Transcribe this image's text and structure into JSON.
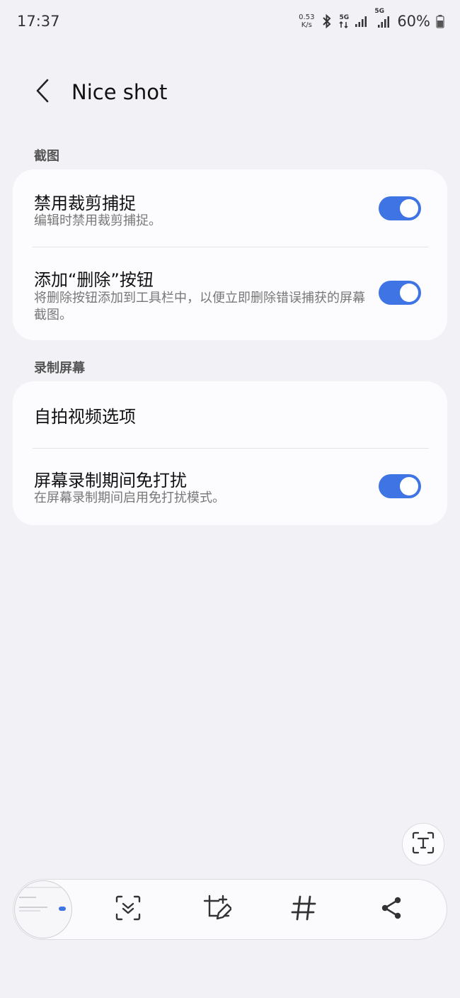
{
  "status_bar": {
    "time": "17:37",
    "net_speed_value": "0.53",
    "net_speed_unit": "K/s",
    "sig1_label": "5G",
    "sig2_label": "5G",
    "battery": "60%"
  },
  "header": {
    "title": "Nice shot"
  },
  "sections": {
    "screenshot": {
      "label": "截图",
      "rows": [
        {
          "title": "禁用裁剪捕捉",
          "subtitle": "编辑时禁用裁剪捕捉。",
          "toggle": true
        },
        {
          "title": "添加“删除”按钮",
          "subtitle": "将删除按钮添加到工具栏中，以便立即删除错误捕获的屏幕截图。",
          "toggle": true
        }
      ]
    },
    "screen_record": {
      "label": "录制屏幕",
      "rows": [
        {
          "title": "自拍视频选项"
        },
        {
          "title": "屏幕录制期间免打扰",
          "subtitle": "在屏幕录制期间启用免打扰模式。",
          "toggle": true
        }
      ]
    }
  },
  "toolbar": {
    "items": [
      "scroll-capture-icon",
      "crop-edit-icon",
      "hashtag-icon",
      "share-icon"
    ]
  },
  "colors": {
    "accent": "#3e74e4",
    "background": "#f2f1f6",
    "card": "#fcfcfe"
  }
}
